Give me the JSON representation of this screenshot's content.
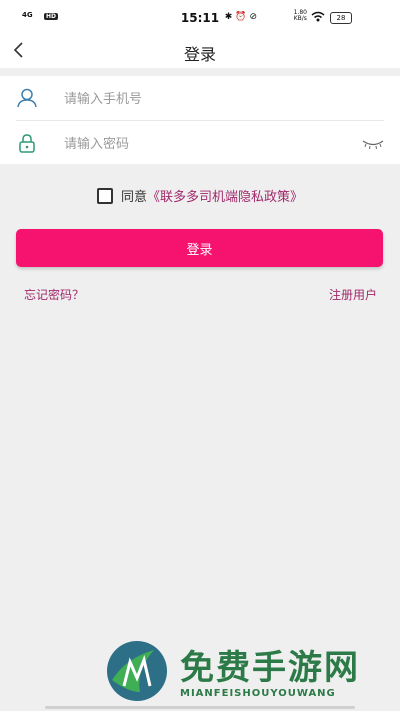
{
  "status_bar": {
    "network": "4G",
    "hd": "HD",
    "time": "15:11",
    "icons": "✱⏰⊘",
    "net_speed_value": "1.80",
    "net_speed_unit": "KB/s",
    "battery": "28"
  },
  "header": {
    "title": "登录",
    "back_icon": "chevron-left-icon"
  },
  "form": {
    "phone_placeholder": "请输入手机号",
    "phone_value": "",
    "password_placeholder": "请输入密码",
    "password_value": "",
    "user_icon": "user-icon",
    "lock_icon": "lock-icon",
    "eye_icon": "eye-closed-icon"
  },
  "agreement": {
    "checked": false,
    "prefix": "同意",
    "policy_link": "《联多多司机端隐私政策》"
  },
  "login_button_label": "登录",
  "links": {
    "forgot_password": "忘记密码？",
    "register": "注册用户"
  },
  "watermark": {
    "title": "免费手游网",
    "subtitle": "MIANFEISHOUYOUWANG"
  },
  "colors": {
    "accent": "#f5136f",
    "link": "#a0296b",
    "icon": "#3f7fae",
    "background": "#efefef"
  }
}
